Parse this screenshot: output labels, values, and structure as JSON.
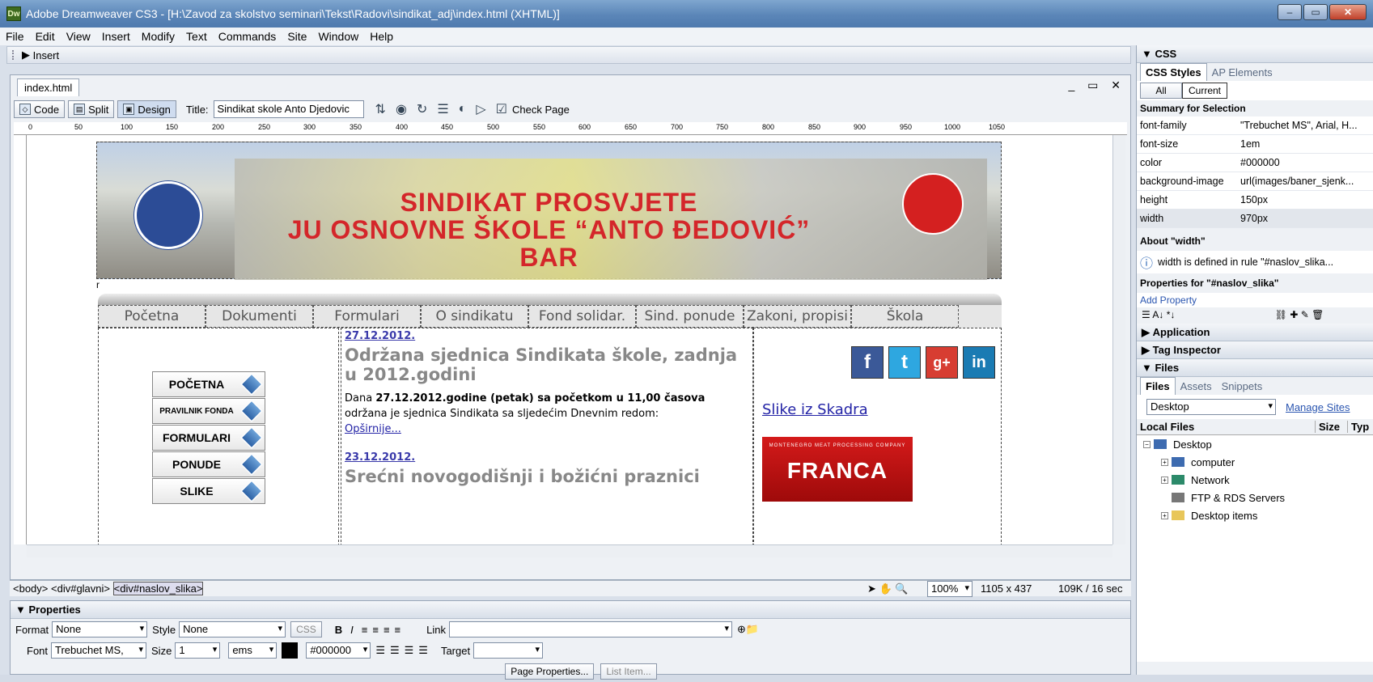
{
  "window": {
    "title": "Adobe Dreamweaver CS3 - [H:\\Zavod za skolstvo seminari\\Tekst\\Radovi\\sindikat_adj\\index.html (XHTML)]",
    "app_icon": "Dw"
  },
  "menu": [
    "File",
    "Edit",
    "View",
    "Insert",
    "Modify",
    "Text",
    "Commands",
    "Site",
    "Window",
    "Help"
  ],
  "insert_bar": {
    "label": "Insert"
  },
  "doc": {
    "tab": "index.html",
    "code": "Code",
    "split": "Split",
    "design": "Design",
    "title_label": "Title:",
    "title_value": "Sindikat skole Anto Djedovic",
    "check_page": "Check Page"
  },
  "ruler": [
    "0",
    "50",
    "100",
    "150",
    "200",
    "250",
    "300",
    "350",
    "400",
    "450",
    "500",
    "550",
    "600",
    "650",
    "700",
    "750",
    "800",
    "850",
    "900",
    "950",
    "1000",
    "1050"
  ],
  "page": {
    "banner": [
      "SINDIKAT PROSVJETE",
      "JU OSNOVNE ŠKOLE “ANTO ĐEDOVIĆ”",
      "BAR"
    ],
    "br": "r",
    "nav": [
      "Početna",
      "Dokumenti",
      "Formulari",
      "O sindikatu",
      "Fond solidar.",
      "Sind. ponude",
      "Zakoni, propisi",
      "Škola"
    ],
    "side": [
      "POČETNA",
      "PRAVILNIK FONDA",
      "FORMULARI",
      "PONUDE",
      "SLIKE"
    ],
    "post1": {
      "date": "27.12.2012.",
      "title": "Održana sjednica Sindikata škole, zadnja u 2012.godini",
      "text_pre": "Dana ",
      "text_bold": "27.12.2012.godine (petak) sa početkom u 11,00 časova",
      "text_post": " održana je sjednica Sindikata sa sljedećim Dnevnim redom:",
      "more": "Opširnije..."
    },
    "post2": {
      "date": "23.12.2012.",
      "title": "Srećni novogodišnji i božićni praznici"
    },
    "social": [
      "f",
      "t",
      "g+",
      "in"
    ],
    "right_link": "Slike iz Skadra",
    "franca_small": "MONTENEGRO MEAT PROCESSING COMPANY",
    "franca": "FRANCA"
  },
  "tag_selector": {
    "t1": "<body>",
    "t2": "<div#glavni>",
    "t3": "<div#naslov_slika>"
  },
  "status": {
    "zoom": "100%",
    "size": "1105 x 437",
    "weight": "109K / 16 sec"
  },
  "properties": {
    "header": "Properties",
    "format_label": "Format",
    "format": "None",
    "style_label": "Style",
    "style": "None",
    "css": "CSS",
    "link_label": "Link",
    "font_label": "Font",
    "font": "Trebuchet MS,",
    "size_label": "Size",
    "size": "1",
    "unit": "ems",
    "color": "#000000",
    "target_label": "Target",
    "page_props": "Page Properties...",
    "list_item": "List Item..."
  },
  "css_panel": {
    "header": "CSS",
    "tab1": "CSS Styles",
    "tab2": "AP Elements",
    "all": "All",
    "current": "Current",
    "summary": "Summary for Selection",
    "rows": [
      [
        "font-family",
        "\"Trebuchet MS\", Arial, H..."
      ],
      [
        "font-size",
        "1em"
      ],
      [
        "color",
        "#000000"
      ],
      [
        "background-image",
        "url(images/baner_sjenk..."
      ],
      [
        "height",
        "150px"
      ],
      [
        "width",
        "970px"
      ]
    ],
    "about": "About \"width\"",
    "about_text": "width is defined in rule \"#naslov_slika...",
    "props_for": "Properties for \"#naslov_slika\"",
    "add_prop": "Add Property"
  },
  "application": "Application",
  "tag_inspector": "Tag Inspector",
  "files": {
    "header": "Files",
    "tabs": [
      "Files",
      "Assets",
      "Snippets"
    ],
    "site": "Desktop",
    "manage": "Manage Sites",
    "col_local": "Local Files",
    "col_size": "Size",
    "col_type": "Typ",
    "tree": [
      "Desktop",
      "computer",
      "Network",
      "FTP & RDS Servers",
      "Desktop items"
    ]
  }
}
